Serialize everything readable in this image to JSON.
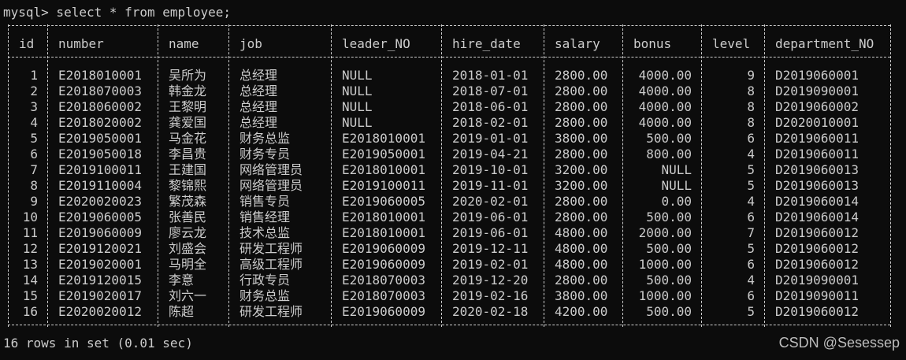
{
  "terminal": {
    "prompt": "mysql> select * from employee;",
    "status": "16 rows in set (0.01 sec)",
    "watermark": "CSDN @Sesessep"
  },
  "table": {
    "columns": [
      "id",
      "number",
      "name",
      "job",
      "leader_NO",
      "hire_date",
      "salary",
      "bonus",
      "level",
      "department_NO"
    ],
    "rows": [
      [
        "1",
        "E2018010001",
        "吴所为",
        "总经理",
        "NULL",
        "2018-01-01",
        "2800.00",
        "4000.00",
        "9",
        "D2019060001"
      ],
      [
        "2",
        "E2018070003",
        "韩金龙",
        "总经理",
        "NULL",
        "2018-07-01",
        "2800.00",
        "4000.00",
        "8",
        "D2019090001"
      ],
      [
        "3",
        "E2018060002",
        "王黎明",
        "总经理",
        "NULL",
        "2018-06-01",
        "2800.00",
        "4000.00",
        "8",
        "D2019060002"
      ],
      [
        "4",
        "E2018020002",
        "龚爱国",
        "总经理",
        "NULL",
        "2018-02-01",
        "2800.00",
        "4000.00",
        "8",
        "D2020010001"
      ],
      [
        "5",
        "E2019050001",
        "马金花",
        "财务总监",
        "E2018010001",
        "2019-01-01",
        "3800.00",
        "500.00",
        "6",
        "D2019060011"
      ],
      [
        "6",
        "E2019050018",
        "李昌贵",
        "财务专员",
        "E2019050001",
        "2019-04-21",
        "2800.00",
        "800.00",
        "4",
        "D2019060011"
      ],
      [
        "7",
        "E2019100011",
        "王建国",
        "网络管理员",
        "E2018010001",
        "2019-10-01",
        "3200.00",
        "NULL",
        "5",
        "D2019060013"
      ],
      [
        "8",
        "E2019110004",
        "黎锦熙",
        "网络管理员",
        "E2019100011",
        "2019-11-01",
        "3200.00",
        "NULL",
        "5",
        "D2019060013"
      ],
      [
        "9",
        "E2020020023",
        "繁茂森",
        "销售专员",
        "E2019060005",
        "2020-02-01",
        "2800.00",
        "0.00",
        "4",
        "D2019060014"
      ],
      [
        "10",
        "E2019060005",
        "张善民",
        "销售经理",
        "E2018010001",
        "2019-06-01",
        "2800.00",
        "500.00",
        "6",
        "D2019060014"
      ],
      [
        "11",
        "E2019060009",
        "廖云龙",
        "技术总监",
        "E2018010001",
        "2019-06-01",
        "4800.00",
        "2000.00",
        "7",
        "D2019060012"
      ],
      [
        "12",
        "E2019120021",
        "刘盛会",
        "研发工程师",
        "E2019060009",
        "2019-12-11",
        "4800.00",
        "500.00",
        "5",
        "D2019060012"
      ],
      [
        "13",
        "E2019020001",
        "马明全",
        "高级工程师",
        "E2019060009",
        "2019-02-01",
        "4800.00",
        "1000.00",
        "6",
        "D2019060012"
      ],
      [
        "14",
        "E2019120015",
        "李意",
        "行政专员",
        "E2018070003",
        "2019-12-20",
        "2800.00",
        "500.00",
        "4",
        "D2019090001"
      ],
      [
        "15",
        "E2019020017",
        "刘六一",
        "财务总监",
        "E2018070003",
        "2019-02-16",
        "3800.00",
        "1000.00",
        "6",
        "D2019090011"
      ],
      [
        "16",
        "E2020020012",
        "陈超",
        "研发工程师",
        "E2019060009",
        "2020-02-18",
        "4200.00",
        "500.00",
        "5",
        "D2019060012"
      ]
    ]
  },
  "colors": {
    "background": "#0c0c0c",
    "text": "#cccccc"
  }
}
